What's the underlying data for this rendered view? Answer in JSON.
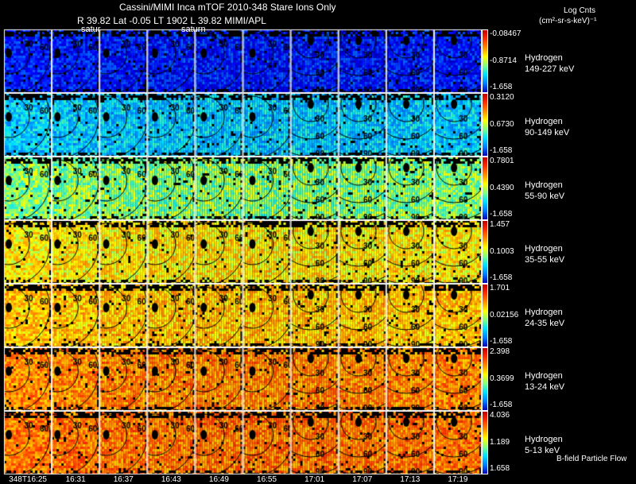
{
  "header": {
    "title": "Cassini/MIMI Inca mTOF  2010-348   Stare   Ions Only",
    "subtitle": "R        39.82 Lat -0.05 LT 1902 L          39.82  MIMI/APL",
    "saturn_label_1": "satur",
    "saturn_label_2": "saturn",
    "units_line1": "Log Cnts",
    "units_line2": "(cm²-sr-s-keV)⁻¹"
  },
  "chart_data": {
    "type": "heatmap",
    "title": "Cassini/MIMI Inca mTOF  2010-348   Stare   Ions Only",
    "colormap": "jet",
    "columns": [
      "348T16:25",
      "16:31",
      "16:37",
      "16:43",
      "16:49",
      "16:55",
      "17:01",
      "17:07",
      "17:13",
      "17:19"
    ],
    "contour_labels": [
      "30",
      "60",
      "90"
    ],
    "rows": [
      {
        "species": "Hydrogen",
        "energy": "149-227 keV",
        "cb_max": "-0.08467",
        "cb_mid": "-0.8714",
        "cb_min": "-1.658",
        "level": 0.15
      },
      {
        "species": "Hydrogen",
        "energy": "90-149 keV",
        "cb_max": "0.3120",
        "cb_mid": "0.6730",
        "cb_min": "-1.658",
        "level": 0.38
      },
      {
        "species": "Hydrogen",
        "energy": "55-90 keV",
        "cb_max": "0.7801",
        "cb_mid": "0.4390",
        "cb_min": "-1.658",
        "level": 0.55
      },
      {
        "species": "Hydrogen",
        "energy": "35-55 keV",
        "cb_max": "1.457",
        "cb_mid": "0.1003",
        "cb_min": "-1.658",
        "level": 0.68
      },
      {
        "species": "Hydrogen",
        "energy": "24-35 keV",
        "cb_max": "1.701",
        "cb_mid": "0.02156",
        "cb_min": "-1.658",
        "level": 0.72
      },
      {
        "species": "Hydrogen",
        "energy": "13-24 keV",
        "cb_max": "2.398",
        "cb_mid": "0.3699",
        "cb_min": "-1.658",
        "level": 0.8
      },
      {
        "species": "Hydrogen",
        "energy": "5-13 keV",
        "cb_max": "4.036",
        "cb_mid": "1.189",
        "cb_min": "1.658",
        "level": 0.82
      }
    ],
    "footnote": "B-field Particle Flow"
  }
}
